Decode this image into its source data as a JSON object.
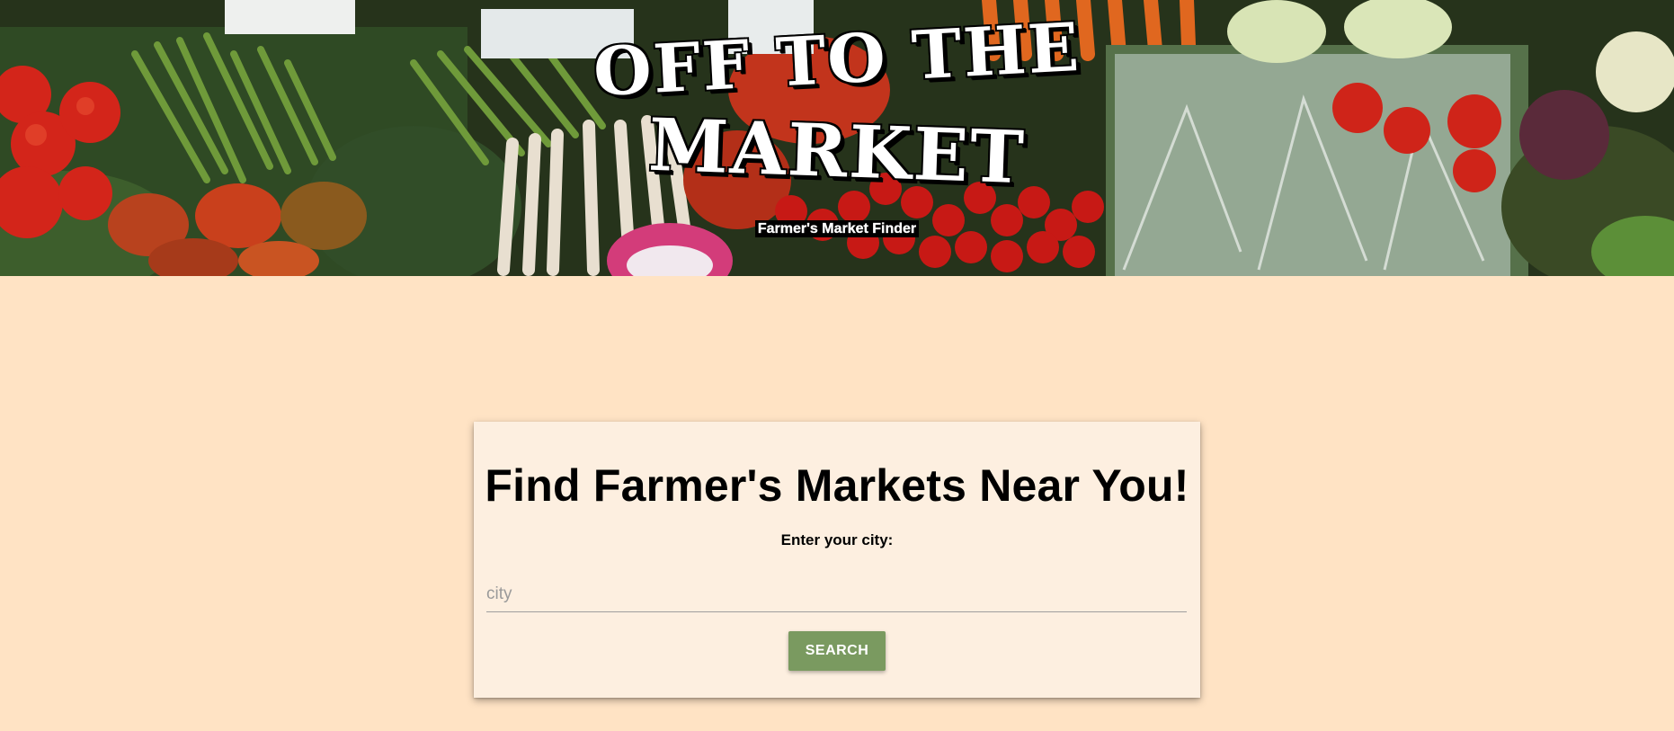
{
  "header": {
    "title_line1": "OFF TO THE",
    "title_line2": "MARKET",
    "tagline": "Farmer's Market Finder"
  },
  "search": {
    "heading": "Find Farmer's Markets Near You!",
    "label": "Enter your city:",
    "placeholder": "city",
    "value": "",
    "button_label": "SEARCH"
  },
  "colors": {
    "page_background": "#ffe3c4",
    "card_background": "#fdefe0",
    "button": "#7a9a60",
    "button_text": "#ffffff"
  }
}
